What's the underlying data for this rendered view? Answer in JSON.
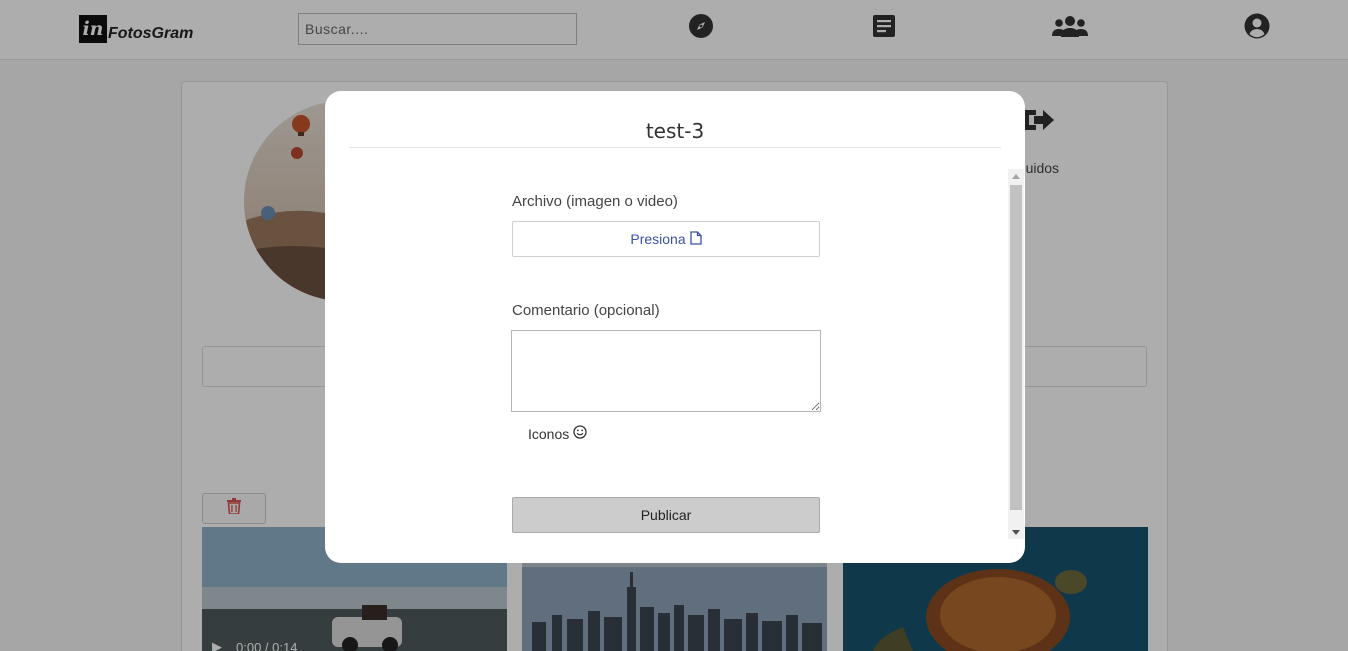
{
  "app": {
    "logo_mark": "in",
    "name": "FotosGram"
  },
  "search": {
    "placeholder": "Buscar...."
  },
  "nav": {
    "icons": [
      "compass-icon",
      "posts-icon",
      "users-icon",
      "account-icon"
    ]
  },
  "profile": {
    "stat_label": "eguidos"
  },
  "video": {
    "time": "0:00 / 0:14"
  },
  "modal": {
    "title": "test-3",
    "file_label": "Archivo (imagen o video)",
    "file_button": "Presiona",
    "comment_label": "Comentario (opcional)",
    "comment_value": "",
    "icons_toggle": "Iconos",
    "publish_button": "Publicar"
  },
  "colors": {
    "link_blue": "#3a52a5",
    "delete_red": "#d9534f",
    "overlay": "rgba(0,0,0,0.32)"
  }
}
